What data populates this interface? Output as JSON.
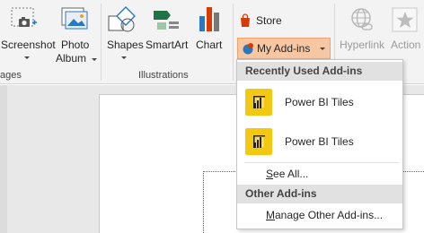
{
  "ribbon": {
    "screenshot": {
      "label": "Screenshot"
    },
    "photo_album": {
      "label_line1": "Photo",
      "label_line2": "Album"
    },
    "shapes": {
      "label": "Shapes"
    },
    "smartart": {
      "label": "SmartArt"
    },
    "chart": {
      "label": "Chart"
    },
    "store": {
      "label": "Store"
    },
    "my_addins": {
      "label": "My Add-ins"
    },
    "hyperlink": {
      "label": "Hyperlink"
    },
    "action": {
      "label": "Action"
    },
    "groups": {
      "images_partial": "ages",
      "illustrations": "Illustrations"
    }
  },
  "dropdown": {
    "recent_header": "Recently Used Add-ins",
    "recent_items": [
      {
        "label": "Power BI Tiles",
        "icon": "power-bi-tiles-icon"
      },
      {
        "label": "Power BI Tiles",
        "icon": "power-bi-tiles-icon"
      }
    ],
    "see_all": {
      "accel": "S",
      "rest": "ee All..."
    },
    "other_header": "Other Add-ins",
    "manage": {
      "accel": "M",
      "rest": "anage Other Add-ins..."
    }
  },
  "colors": {
    "ribbon_bg": "#f3f3f3",
    "active_button_bg": "#f7c6a3",
    "active_button_border": "#f0a46d",
    "tile_yellow": "#f2c811",
    "header_bg": "#e1e1e1",
    "store_red": "#d83b01"
  }
}
